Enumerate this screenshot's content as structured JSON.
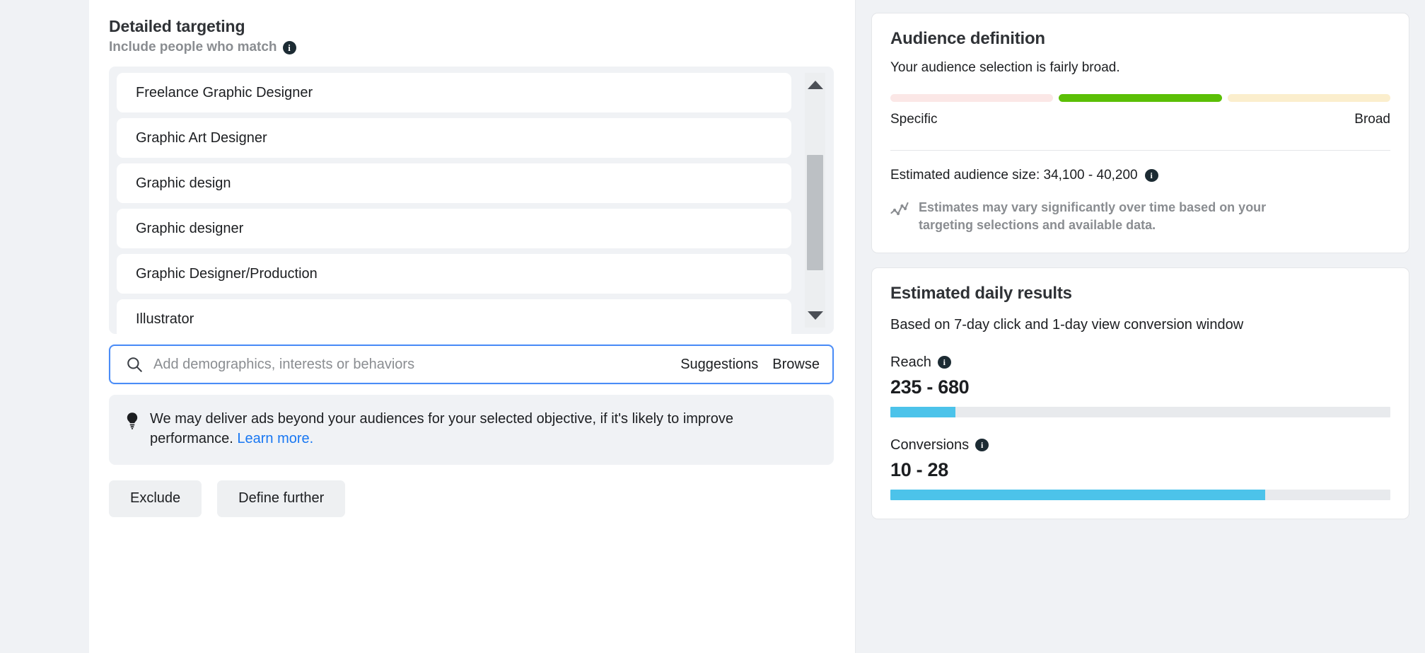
{
  "detailed_targeting": {
    "title": "Detailed targeting",
    "subtitle": "Include people who match",
    "info_icon_glyph": "i",
    "suggestions": [
      {
        "label": "Freelance Graphic Designer"
      },
      {
        "label": "Graphic Art Designer"
      },
      {
        "label": "Graphic design"
      },
      {
        "label": "Graphic designer"
      },
      {
        "label": "Graphic Designer/Production"
      },
      {
        "label": "Illustrator"
      }
    ],
    "scrollbar": {
      "up_arrow": "scroll-up",
      "down_arrow": "scroll-down",
      "thumb_top_pct": 28,
      "thumb_height_pct": 56
    },
    "search": {
      "placeholder": "Add demographics, interests or behaviors",
      "value": "",
      "suggestions_label": "Suggestions",
      "browse_label": "Browse"
    },
    "notice": {
      "icon": "lightbulb-icon",
      "text": "We may deliver ads beyond your audiences for your selected objective, if it's likely to improve performance.",
      "link_label": "Learn more."
    },
    "buttons": {
      "exclude": "Exclude",
      "define_further": "Define further"
    }
  },
  "audience_definition": {
    "title": "Audience definition",
    "description": "Your audience selection is fairly broad.",
    "meter": {
      "segments": [
        {
          "name": "specific",
          "color": "#fbe7e6",
          "active": false
        },
        {
          "name": "balanced",
          "color": "#5bbf06",
          "active": true
        },
        {
          "name": "broad",
          "color": "#fbeecd",
          "active": false
        }
      ],
      "left_label": "Specific",
      "right_label": "Broad"
    },
    "estimated_size_label": "Estimated audience size: 34,100 - 40,200",
    "estimated_size_value": "34,100 - 40,200",
    "info_icon_glyph": "i",
    "variance_note": "Estimates may vary significantly over time based on your targeting selections and available data.",
    "variance_icon": "line-chart-icon"
  },
  "estimated_daily_results": {
    "title": "Estimated daily results",
    "subtitle": "Based on 7-day click and 1-day view conversion window",
    "metrics": [
      {
        "label": "Reach",
        "value": "235 - 680",
        "fill_pct": 13,
        "fill_color": "#4cc3ea",
        "info_icon_glyph": "i"
      },
      {
        "label": "Conversions",
        "value": "10 - 28",
        "fill_pct": 75,
        "fill_color": "#4cc3ea",
        "info_icon_glyph": "i"
      }
    ]
  },
  "colors": {
    "page_background": "#f0f2f5",
    "panel_background": "#ffffff",
    "accent_link": "#1877f2",
    "focus_border": "#4a8cf7",
    "meter_active": "#5bbf06",
    "bar_fill": "#4cc3ea"
  }
}
